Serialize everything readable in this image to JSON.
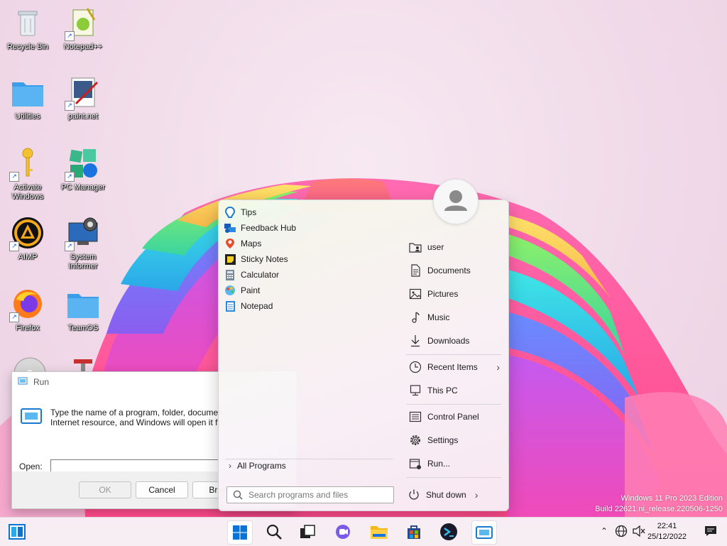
{
  "desktop": {
    "icons": [
      {
        "label": "Recycle Bin",
        "icon": "recycle-bin-icon"
      },
      {
        "label": "Notepad++",
        "icon": "notepad-plus-plus-icon"
      },
      {
        "label": "Utilities",
        "icon": "folder-icon"
      },
      {
        "label": "paint.net",
        "icon": "paint-net-icon"
      },
      {
        "label": "Activate Windows",
        "icon": "key-icon"
      },
      {
        "label": "PC Manager",
        "icon": "pc-manager-icon"
      },
      {
        "label": "AIMP",
        "icon": "aimp-icon"
      },
      {
        "label": "System Informer",
        "icon": "system-informer-icon"
      },
      {
        "label": "Firefox",
        "icon": "firefox-icon"
      },
      {
        "label": "TeamOS",
        "icon": "folder-icon"
      }
    ]
  },
  "run_dialog": {
    "title": "Run",
    "description": "Type the name of a program, folder, document, or Internet resource, and Windows will open it for you.",
    "description_line1": "Type the name of a program, folder, documen",
    "description_line2": "Internet resource, and Windows will open it fo",
    "open_label": "Open:",
    "open_value": "",
    "ok_label": "OK",
    "cancel_label": "Cancel",
    "browse_label": "Brow"
  },
  "start_menu": {
    "programs": [
      {
        "label": "Tips",
        "icon": "tips-icon"
      },
      {
        "label": "Feedback Hub",
        "icon": "feedback-hub-icon"
      },
      {
        "label": "Maps",
        "icon": "maps-icon"
      },
      {
        "label": "Sticky Notes",
        "icon": "sticky-notes-icon"
      },
      {
        "label": "Calculator",
        "icon": "calculator-icon"
      },
      {
        "label": "Paint",
        "icon": "paint-icon"
      },
      {
        "label": "Notepad",
        "icon": "notepad-icon"
      }
    ],
    "all_programs": "All Programs",
    "search_placeholder": "Search programs and files",
    "places": [
      {
        "label": "user",
        "icon": "user-folder-icon"
      },
      {
        "label": "Documents",
        "icon": "document-icon"
      },
      {
        "label": "Pictures",
        "icon": "picture-icon"
      },
      {
        "label": "Music",
        "icon": "music-icon"
      },
      {
        "label": "Downloads",
        "icon": "download-icon"
      },
      {
        "label": "Recent Items",
        "icon": "clock-icon"
      },
      {
        "label": "This PC",
        "icon": "computer-icon"
      },
      {
        "label": "Control Panel",
        "icon": "control-panel-icon"
      },
      {
        "label": "Settings",
        "icon": "gear-icon"
      },
      {
        "label": "Run...",
        "icon": "run-icon"
      }
    ],
    "shutdown_label": "Shut down"
  },
  "watermark": {
    "line1": "Windows 11 Pro 2023 Edition",
    "line2": "Build 22621.ni_release.220506-1250"
  },
  "taskbar": {
    "clock_time": "22:41",
    "clock_date": "25/12/2022",
    "colors": {
      "accent": "#0a74d6",
      "taskbar_bg": "#f6eef3"
    }
  }
}
